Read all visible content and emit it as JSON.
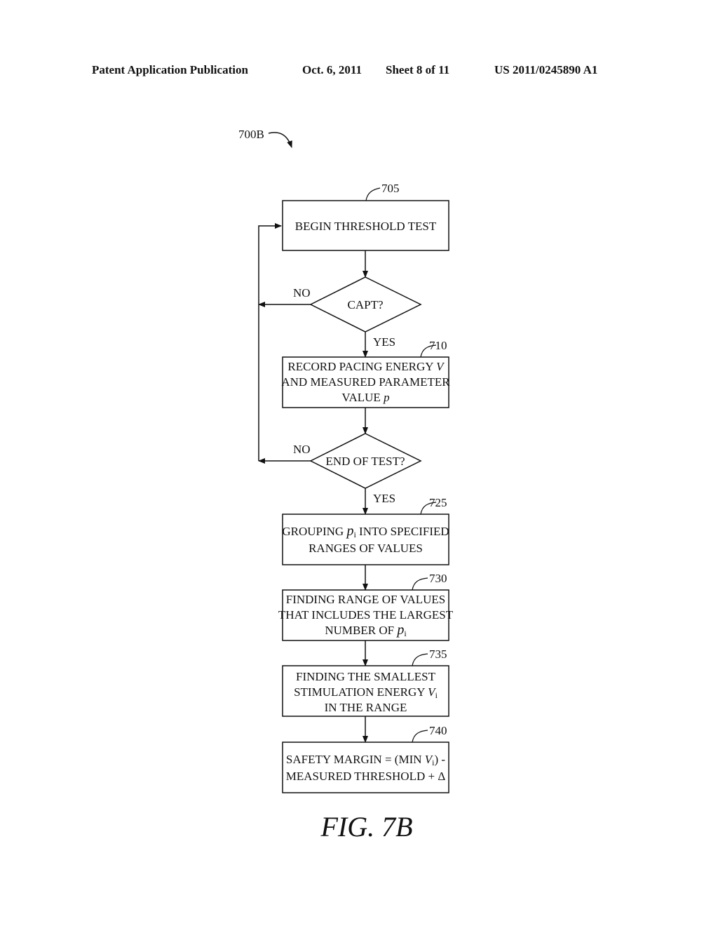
{
  "header": {
    "publication": "Patent Application Publication",
    "date": "Oct. 6, 2011",
    "sheet": "Sheet 8 of 11",
    "number": "US 2011/0245890 A1"
  },
  "diagram": {
    "figure_ref": "700B",
    "figure_label": "FIG. 7B",
    "nodes": [
      {
        "id": "705",
        "type": "process",
        "ref": "705",
        "lines": [
          "BEGIN THRESHOLD TEST"
        ]
      },
      {
        "id": "capt",
        "type": "decision",
        "lines": [
          "CAPT?"
        ],
        "yes": "YES",
        "no": "NO"
      },
      {
        "id": "710",
        "type": "process",
        "ref": "710",
        "lines": [
          "RECORD PACING ENERGY V",
          "AND MEASURED PARAMETER",
          "VALUE p"
        ]
      },
      {
        "id": "end",
        "type": "decision",
        "lines": [
          "END OF TEST?"
        ],
        "yes": "YES",
        "no": "NO"
      },
      {
        "id": "725",
        "type": "process",
        "ref": "725",
        "lines": [
          "GROUPING pi INTO SPECIFIED",
          "RANGES OF VALUES"
        ]
      },
      {
        "id": "730",
        "type": "process",
        "ref": "730",
        "lines": [
          "FINDING RANGE OF VALUES",
          "THAT INCLUDES THE LARGEST",
          "NUMBER OF pi"
        ]
      },
      {
        "id": "735",
        "type": "process",
        "ref": "735",
        "lines": [
          "FINDING THE SMALLEST",
          "STIMULATION ENERGY Vi",
          "IN THE RANGE"
        ]
      },
      {
        "id": "740",
        "type": "process",
        "ref": "740",
        "lines": [
          "SAFETY MARGIN = (MIN Vi) -",
          "MEASURED THRESHOLD + Δ"
        ]
      }
    ],
    "edges": [
      {
        "from": "705",
        "to": "capt"
      },
      {
        "from": "capt",
        "to": "710",
        "label": "YES"
      },
      {
        "from": "capt",
        "to": "705",
        "label": "NO"
      },
      {
        "from": "710",
        "to": "end"
      },
      {
        "from": "end",
        "to": "725",
        "label": "YES"
      },
      {
        "from": "end",
        "to": "705",
        "label": "NO"
      },
      {
        "from": "725",
        "to": "730"
      },
      {
        "from": "730",
        "to": "735"
      },
      {
        "from": "735",
        "to": "740"
      }
    ],
    "text": {
      "t705": "BEGIN THRESHOLD TEST",
      "capt": "CAPT?",
      "t710a": "RECORD PACING ENERGY ",
      "t710a_var": "V",
      "t710b": "AND MEASURED PARAMETER",
      "t710c": "VALUE ",
      "t710c_var": "p",
      "endq": "END OF TEST?",
      "t725a_pre": "GROUPING ",
      "t725a_var": "p",
      "t725a_sub": "i",
      "t725a_post": " INTO SPECIFIED",
      "t725b": "RANGES OF VALUES",
      "t730a": "FINDING RANGE OF VALUES",
      "t730b": "THAT INCLUDES THE LARGEST",
      "t730c_pre": "NUMBER OF ",
      "t730c_var": "p",
      "t730c_sub": "i",
      "t735a": "FINDING THE SMALLEST",
      "t735b_pre": "STIMULATION ENERGY ",
      "t735b_var": "V",
      "t735b_sub": "i",
      "t735c": "IN THE RANGE",
      "t740a_pre": "SAFETY MARGIN = (MIN ",
      "t740a_var": "V",
      "t740a_sub": "i",
      "t740a_post": ") -",
      "t740b": "MEASURED THRESHOLD + Δ",
      "yes": "YES",
      "no": "NO"
    }
  }
}
